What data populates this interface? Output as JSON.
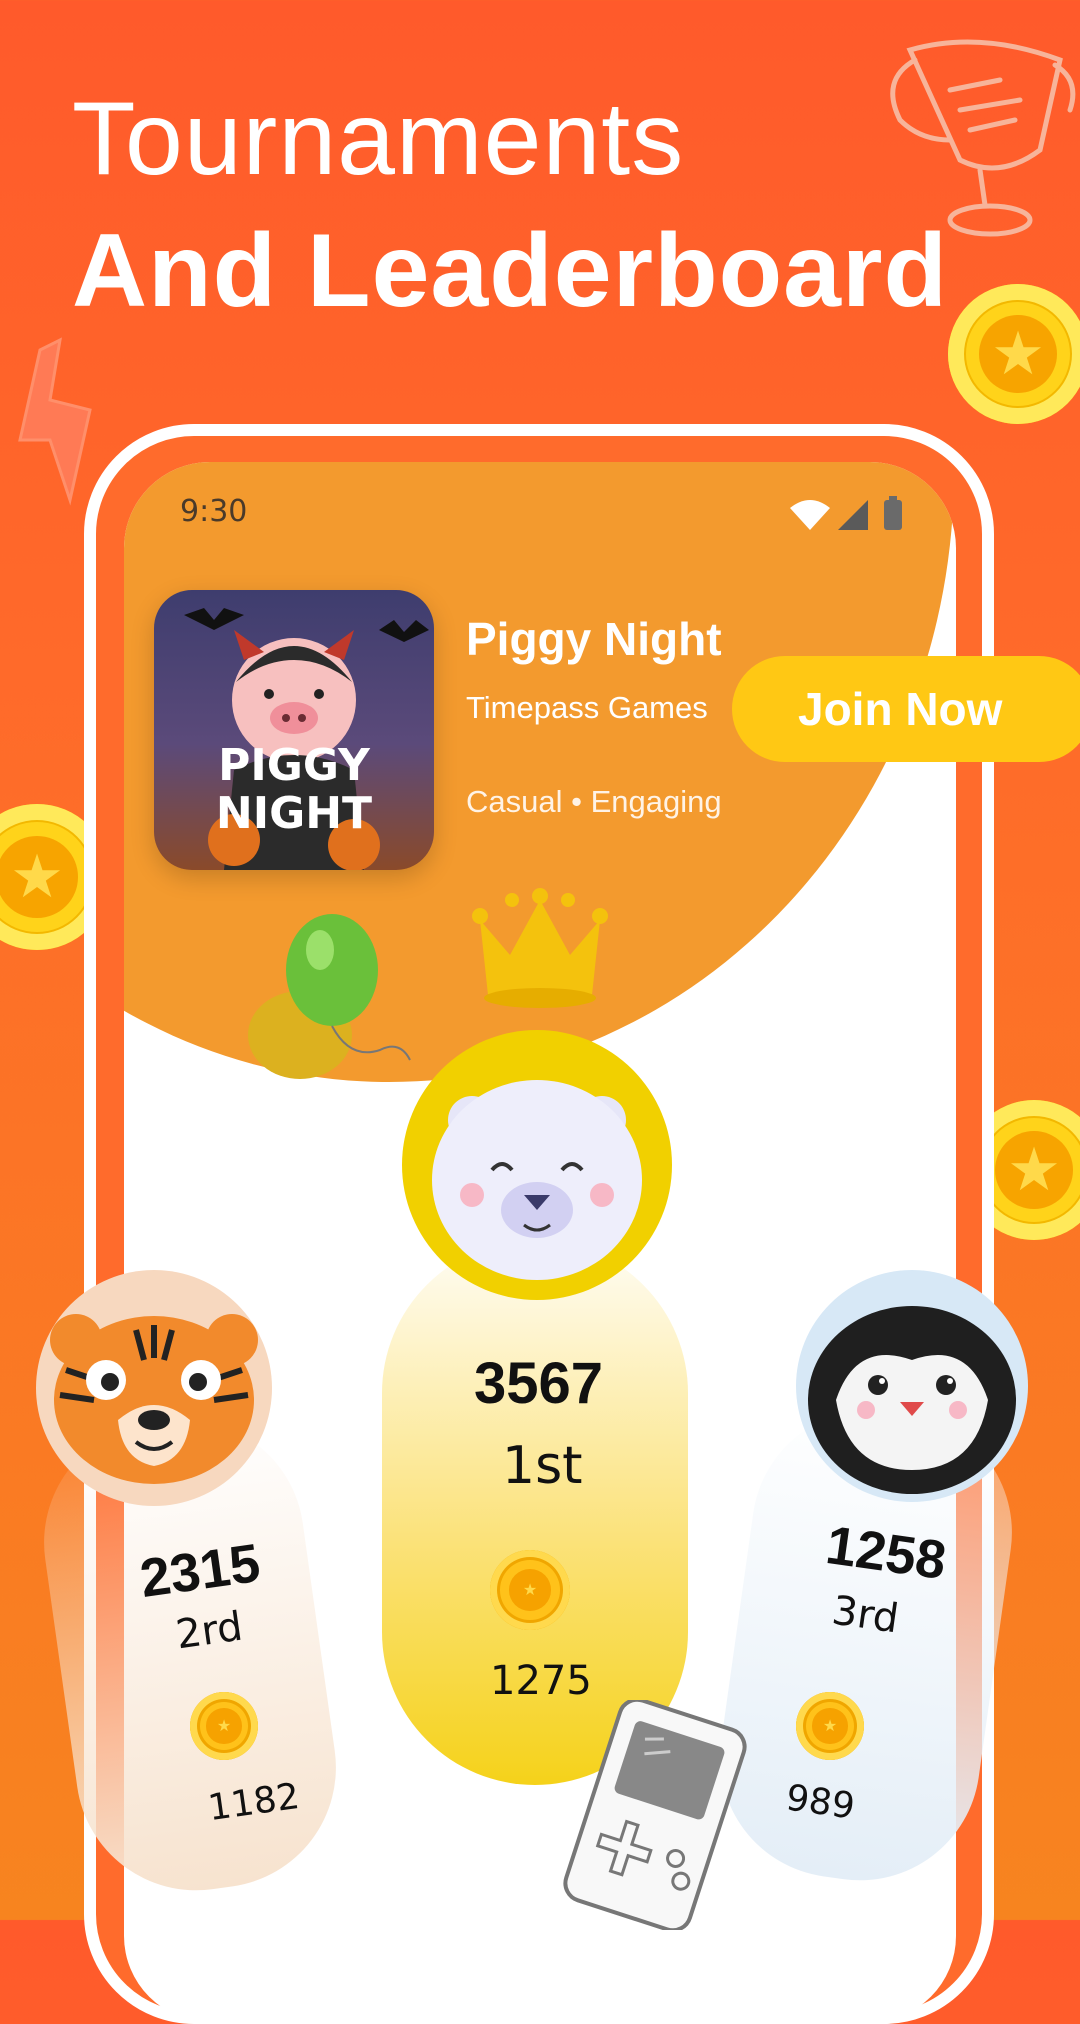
{
  "headline": {
    "line1": "Tournaments",
    "line2": "And Leaderboard"
  },
  "status_bar": {
    "time": "9:30"
  },
  "game": {
    "name": "Piggy Night",
    "studio": "Timepass Games",
    "tags": "Casual • Engaging",
    "art_title_line1": "PIGGY",
    "art_title_line2": "NIGHT"
  },
  "join_button": {
    "label": "Join Now"
  },
  "leaderboard": [
    {
      "place": "1st",
      "score": "3567",
      "prize": "1275",
      "avatar": "polar-bear"
    },
    {
      "place": "2rd",
      "score": "2315",
      "prize": "1182",
      "avatar": "tiger"
    },
    {
      "place": "3rd",
      "score": "1258",
      "prize": "989",
      "avatar": "penguin"
    }
  ],
  "colors": {
    "background": "#ff5a2b",
    "accent": "#ffc814",
    "blob": "#f39a2e"
  },
  "icons": [
    "trophy-icon",
    "coin-icon",
    "crown-icon",
    "balloons-icon",
    "gameboy-icon",
    "wifi-icon",
    "signal-icon",
    "battery-icon"
  ]
}
